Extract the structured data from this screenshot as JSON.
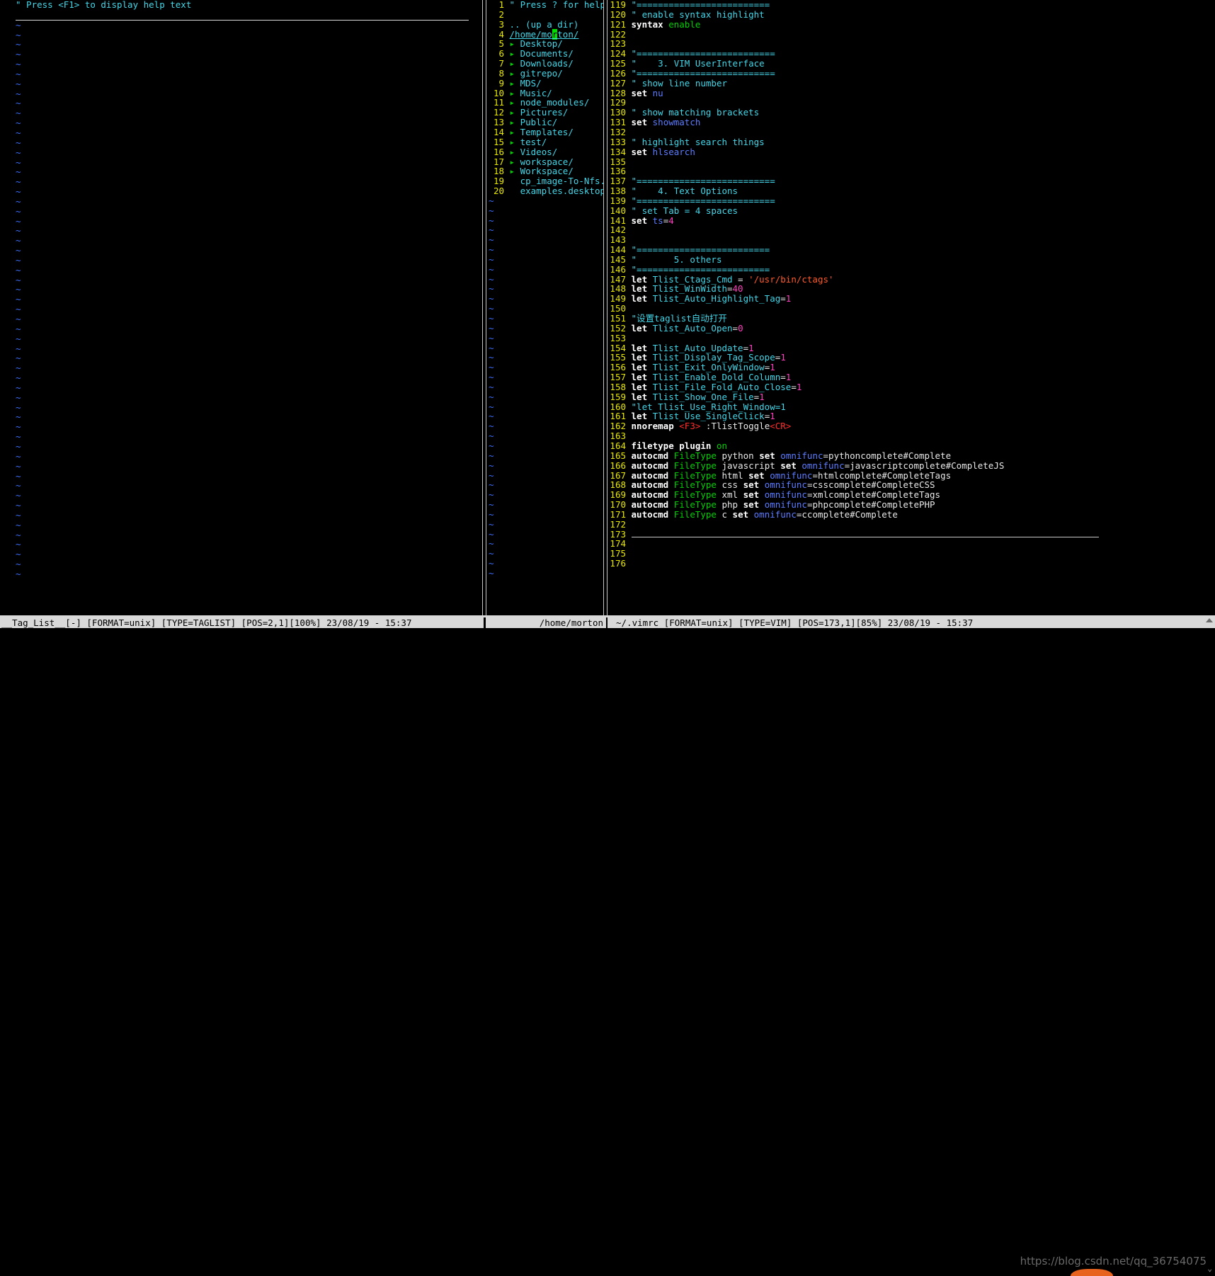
{
  "taglist": {
    "header": "\" Press <F1> to display help text",
    "tilde": "~",
    "tilde_rows": 57
  },
  "netrw": {
    "tilde": "~",
    "tilde_rows": 39,
    "lines": [
      {
        "n": "1",
        "kind": "head",
        "text": "\" Press ? for help"
      },
      {
        "n": "2",
        "kind": "blank",
        "text": ""
      },
      {
        "n": "3",
        "kind": "plain",
        "text": ".. (up a dir)"
      },
      {
        "n": "4",
        "kind": "curdir",
        "pre": "/home/mo",
        "cur": "r",
        "post": "ton/"
      },
      {
        "n": "5",
        "kind": "dir",
        "text": "Desktop/"
      },
      {
        "n": "6",
        "kind": "dir",
        "text": "Documents/"
      },
      {
        "n": "7",
        "kind": "dir",
        "text": "Downloads/"
      },
      {
        "n": "8",
        "kind": "dir",
        "text": "gitrepo/"
      },
      {
        "n": "9",
        "kind": "dir",
        "text": "MDS/"
      },
      {
        "n": "10",
        "kind": "dir",
        "text": "Music/"
      },
      {
        "n": "11",
        "kind": "dir",
        "text": "node_modules/"
      },
      {
        "n": "12",
        "kind": "dir",
        "text": "Pictures/"
      },
      {
        "n": "13",
        "kind": "dir",
        "text": "Public/"
      },
      {
        "n": "14",
        "kind": "dir",
        "text": "Templates/"
      },
      {
        "n": "15",
        "kind": "dir",
        "text": "test/"
      },
      {
        "n": "16",
        "kind": "dir",
        "text": "Videos/"
      },
      {
        "n": "17",
        "kind": "dir",
        "text": "workspace/"
      },
      {
        "n": "18",
        "kind": "dir",
        "text": "Workspace/"
      },
      {
        "n": "19",
        "kind": "file",
        "text": "cp_image-To-Nfs.sh*"
      },
      {
        "n": "20",
        "kind": "file",
        "text": "examples.desktop"
      }
    ],
    "arrow_glyph": "▸"
  },
  "vimrc": {
    "lines": [
      {
        "n": "119",
        "t": [
          {
            "c": "cmt",
            "s": "\"========================="
          }
        ]
      },
      {
        "n": "120",
        "t": [
          {
            "c": "cmt",
            "s": "\" enable syntax highlight"
          }
        ]
      },
      {
        "n": "121",
        "t": [
          {
            "c": "kw",
            "s": "syntax"
          },
          {
            "c": "wht",
            "s": " "
          },
          {
            "c": "grn",
            "s": "enable"
          }
        ]
      },
      {
        "n": "122",
        "t": []
      },
      {
        "n": "123",
        "t": []
      },
      {
        "n": "124",
        "t": [
          {
            "c": "cmt",
            "s": "\"=========================="
          }
        ]
      },
      {
        "n": "125",
        "t": [
          {
            "c": "cmt",
            "s": "\"    3. VIM UserInterface"
          }
        ]
      },
      {
        "n": "126",
        "t": [
          {
            "c": "cmt",
            "s": "\"=========================="
          }
        ]
      },
      {
        "n": "127",
        "t": [
          {
            "c": "cmt",
            "s": "\" show line number"
          }
        ]
      },
      {
        "n": "128",
        "t": [
          {
            "c": "kw",
            "s": "set"
          },
          {
            "c": "wht",
            "s": " "
          },
          {
            "c": "opt",
            "s": "nu"
          }
        ]
      },
      {
        "n": "129",
        "t": []
      },
      {
        "n": "130",
        "t": [
          {
            "c": "cmt",
            "s": "\" show matching brackets"
          }
        ]
      },
      {
        "n": "131",
        "t": [
          {
            "c": "kw",
            "s": "set"
          },
          {
            "c": "wht",
            "s": " "
          },
          {
            "c": "opt",
            "s": "showmatch"
          }
        ]
      },
      {
        "n": "132",
        "t": []
      },
      {
        "n": "133",
        "t": [
          {
            "c": "cmt",
            "s": "\" highlight search things"
          }
        ]
      },
      {
        "n": "134",
        "t": [
          {
            "c": "kw",
            "s": "set"
          },
          {
            "c": "wht",
            "s": " "
          },
          {
            "c": "opt",
            "s": "hlsearch"
          }
        ]
      },
      {
        "n": "135",
        "t": []
      },
      {
        "n": "136",
        "t": []
      },
      {
        "n": "137",
        "t": [
          {
            "c": "cmt",
            "s": "\"=========================="
          }
        ]
      },
      {
        "n": "138",
        "t": [
          {
            "c": "cmt",
            "s": "\"    4. Text Options"
          }
        ]
      },
      {
        "n": "139",
        "t": [
          {
            "c": "cmt",
            "s": "\"=========================="
          }
        ]
      },
      {
        "n": "140",
        "t": [
          {
            "c": "cmt",
            "s": "\" set Tab = 4 spaces"
          }
        ]
      },
      {
        "n": "141",
        "t": [
          {
            "c": "kw",
            "s": "set"
          },
          {
            "c": "wht",
            "s": " "
          },
          {
            "c": "opt",
            "s": "ts"
          },
          {
            "c": "wht",
            "s": "="
          },
          {
            "c": "num",
            "s": "4"
          }
        ]
      },
      {
        "n": "142",
        "t": []
      },
      {
        "n": "143",
        "t": []
      },
      {
        "n": "144",
        "t": [
          {
            "c": "cmt",
            "s": "\"========================="
          }
        ]
      },
      {
        "n": "145",
        "t": [
          {
            "c": "cmt",
            "s": "\"       5. others"
          }
        ]
      },
      {
        "n": "146",
        "t": [
          {
            "c": "cmt",
            "s": "\"========================="
          }
        ]
      },
      {
        "n": "147",
        "t": [
          {
            "c": "kw",
            "s": "let"
          },
          {
            "c": "wht",
            "s": " "
          },
          {
            "c": "id",
            "s": "Tlist_Ctags_Cmd"
          },
          {
            "c": "wht",
            "s": " = "
          },
          {
            "c": "str",
            "s": "'/usr/bin/ctags'"
          }
        ]
      },
      {
        "n": "148",
        "t": [
          {
            "c": "kw",
            "s": "let"
          },
          {
            "c": "wht",
            "s": " "
          },
          {
            "c": "id",
            "s": "Tlist_WinWidth"
          },
          {
            "c": "wht",
            "s": "="
          },
          {
            "c": "num",
            "s": "40"
          }
        ]
      },
      {
        "n": "149",
        "t": [
          {
            "c": "kw",
            "s": "let"
          },
          {
            "c": "wht",
            "s": " "
          },
          {
            "c": "id",
            "s": "Tlist_Auto_Highlight_Tag"
          },
          {
            "c": "wht",
            "s": "="
          },
          {
            "c": "num",
            "s": "1"
          }
        ]
      },
      {
        "n": "150",
        "t": []
      },
      {
        "n": "151",
        "t": [
          {
            "c": "cmt",
            "s": "\""
          },
          {
            "c": "cjk",
            "s": "设置"
          },
          {
            "c": "cmt",
            "s": "taglist"
          },
          {
            "c": "cjk",
            "s": "自动打开"
          }
        ]
      },
      {
        "n": "152",
        "t": [
          {
            "c": "kw",
            "s": "let"
          },
          {
            "c": "wht",
            "s": " "
          },
          {
            "c": "id",
            "s": "Tlist_Auto_Open"
          },
          {
            "c": "wht",
            "s": "="
          },
          {
            "c": "num",
            "s": "0"
          }
        ]
      },
      {
        "n": "153",
        "t": []
      },
      {
        "n": "154",
        "t": [
          {
            "c": "kw",
            "s": "let"
          },
          {
            "c": "wht",
            "s": " "
          },
          {
            "c": "id",
            "s": "Tlist_Auto_Update"
          },
          {
            "c": "wht",
            "s": "="
          },
          {
            "c": "num",
            "s": "1"
          }
        ]
      },
      {
        "n": "155",
        "t": [
          {
            "c": "kw",
            "s": "let"
          },
          {
            "c": "wht",
            "s": " "
          },
          {
            "c": "id",
            "s": "Tlist_Display_Tag_Scope"
          },
          {
            "c": "wht",
            "s": "="
          },
          {
            "c": "num",
            "s": "1"
          }
        ]
      },
      {
        "n": "156",
        "t": [
          {
            "c": "kw",
            "s": "let"
          },
          {
            "c": "wht",
            "s": " "
          },
          {
            "c": "id",
            "s": "Tlist_Exit_OnlyWindow"
          },
          {
            "c": "wht",
            "s": "="
          },
          {
            "c": "num",
            "s": "1"
          }
        ]
      },
      {
        "n": "157",
        "t": [
          {
            "c": "kw",
            "s": "let"
          },
          {
            "c": "wht",
            "s": " "
          },
          {
            "c": "id",
            "s": "Tlist_Enable_Dold_Column"
          },
          {
            "c": "wht",
            "s": "="
          },
          {
            "c": "num",
            "s": "1"
          }
        ]
      },
      {
        "n": "158",
        "t": [
          {
            "c": "kw",
            "s": "let"
          },
          {
            "c": "wht",
            "s": " "
          },
          {
            "c": "id",
            "s": "Tlist_File_Fold_Auto_Close"
          },
          {
            "c": "wht",
            "s": "="
          },
          {
            "c": "num",
            "s": "1"
          }
        ]
      },
      {
        "n": "159",
        "t": [
          {
            "c": "kw",
            "s": "let"
          },
          {
            "c": "wht",
            "s": " "
          },
          {
            "c": "id",
            "s": "Tlist_Show_One_File"
          },
          {
            "c": "wht",
            "s": "="
          },
          {
            "c": "num",
            "s": "1"
          }
        ]
      },
      {
        "n": "160",
        "t": [
          {
            "c": "cmt",
            "s": "\"let Tlist_Use_Right_Window=1"
          }
        ]
      },
      {
        "n": "161",
        "t": [
          {
            "c": "kw",
            "s": "let"
          },
          {
            "c": "wht",
            "s": " "
          },
          {
            "c": "id",
            "s": "Tlist_Use_SingleClick"
          },
          {
            "c": "wht",
            "s": "="
          },
          {
            "c": "num",
            "s": "1"
          }
        ]
      },
      {
        "n": "162",
        "t": [
          {
            "c": "kw",
            "s": "nnoremap"
          },
          {
            "c": "wht",
            "s": " "
          },
          {
            "c": "red",
            "s": "<F3>"
          },
          {
            "c": "wht",
            "s": " :TlistToggle"
          },
          {
            "c": "red",
            "s": "<CR>"
          }
        ]
      },
      {
        "n": "163",
        "t": []
      },
      {
        "n": "164",
        "t": [
          {
            "c": "kw",
            "s": "filetype"
          },
          {
            "c": "wht",
            "s": " "
          },
          {
            "c": "kw",
            "s": "plugin"
          },
          {
            "c": "wht",
            "s": " "
          },
          {
            "c": "grn",
            "s": "on"
          }
        ]
      },
      {
        "n": "165",
        "t": [
          {
            "c": "kw",
            "s": "autocmd"
          },
          {
            "c": "wht",
            "s": " "
          },
          {
            "c": "grn",
            "s": "FileType"
          },
          {
            "c": "wht",
            "s": " python "
          },
          {
            "c": "kw",
            "s": "set"
          },
          {
            "c": "wht",
            "s": " "
          },
          {
            "c": "opt",
            "s": "omnifunc"
          },
          {
            "c": "wht",
            "s": "=pythoncomplete#Complete"
          }
        ]
      },
      {
        "n": "166",
        "t": [
          {
            "c": "kw",
            "s": "autocmd"
          },
          {
            "c": "wht",
            "s": " "
          },
          {
            "c": "grn",
            "s": "FileType"
          },
          {
            "c": "wht",
            "s": " javascript "
          },
          {
            "c": "kw",
            "s": "set"
          },
          {
            "c": "wht",
            "s": " "
          },
          {
            "c": "opt",
            "s": "omnifunc"
          },
          {
            "c": "wht",
            "s": "=javascriptcomplete#CompleteJS"
          }
        ]
      },
      {
        "n": "167",
        "t": [
          {
            "c": "kw",
            "s": "autocmd"
          },
          {
            "c": "wht",
            "s": " "
          },
          {
            "c": "grn",
            "s": "FileType"
          },
          {
            "c": "wht",
            "s": " html "
          },
          {
            "c": "kw",
            "s": "set"
          },
          {
            "c": "wht",
            "s": " "
          },
          {
            "c": "opt",
            "s": "omnifunc"
          },
          {
            "c": "wht",
            "s": "=htmlcomplete#CompleteTags"
          }
        ]
      },
      {
        "n": "168",
        "t": [
          {
            "c": "kw",
            "s": "autocmd"
          },
          {
            "c": "wht",
            "s": " "
          },
          {
            "c": "grn",
            "s": "FileType"
          },
          {
            "c": "wht",
            "s": " css "
          },
          {
            "c": "kw",
            "s": "set"
          },
          {
            "c": "wht",
            "s": " "
          },
          {
            "c": "opt",
            "s": "omnifunc"
          },
          {
            "c": "wht",
            "s": "=csscomplete#CompleteCSS"
          }
        ]
      },
      {
        "n": "169",
        "t": [
          {
            "c": "kw",
            "s": "autocmd"
          },
          {
            "c": "wht",
            "s": " "
          },
          {
            "c": "grn",
            "s": "FileType"
          },
          {
            "c": "wht",
            "s": " xml "
          },
          {
            "c": "kw",
            "s": "set"
          },
          {
            "c": "wht",
            "s": " "
          },
          {
            "c": "opt",
            "s": "omnifunc"
          },
          {
            "c": "wht",
            "s": "=xmlcomplete#CompleteTags"
          }
        ]
      },
      {
        "n": "170",
        "t": [
          {
            "c": "kw",
            "s": "autocmd"
          },
          {
            "c": "wht",
            "s": " "
          },
          {
            "c": "grn",
            "s": "FileType"
          },
          {
            "c": "wht",
            "s": " php "
          },
          {
            "c": "kw",
            "s": "set"
          },
          {
            "c": "wht",
            "s": " "
          },
          {
            "c": "opt",
            "s": "omnifunc"
          },
          {
            "c": "wht",
            "s": "=phpcomplete#CompletePHP"
          }
        ]
      },
      {
        "n": "171",
        "t": [
          {
            "c": "kw",
            "s": "autocmd"
          },
          {
            "c": "wht",
            "s": " "
          },
          {
            "c": "grn",
            "s": "FileType"
          },
          {
            "c": "wht",
            "s": " c "
          },
          {
            "c": "kw",
            "s": "set"
          },
          {
            "c": "wht",
            "s": " "
          },
          {
            "c": "opt",
            "s": "omnifunc"
          },
          {
            "c": "wht",
            "s": "=ccomplete#Complete"
          }
        ]
      },
      {
        "n": "172",
        "t": []
      },
      {
        "n": "173",
        "t": [
          {
            "c": "rule",
            "s": ""
          }
        ]
      },
      {
        "n": "174",
        "t": []
      },
      {
        "n": "175",
        "t": []
      },
      {
        "n": "176",
        "t": []
      }
    ]
  },
  "status": {
    "left": "__Tag_List__[-] [FORMAT=unix] [TYPE=TAGLIST] [POS=2,1][100%] 23/08/19 - 15:37",
    "middle": "/home/morton",
    "right": "~/.vimrc [FORMAT=unix] [TYPE=VIM] [POS=173,1][85%] 23/08/19 - 15:37"
  },
  "watermark": "https://blog.csdn.net/qq_36754075",
  "scroll_chevron": "⌄",
  "colors": {
    "background": "#000000",
    "comment": "#43d6e8",
    "keyword": "#ffffff",
    "option": "#5c7cff",
    "identifier": "#43d6e8",
    "number": "#ff3fc0",
    "string": "#ff5a2b",
    "special": "#ff2b2b",
    "constant": "#00d000",
    "linenumber": "#e8e800",
    "cursor": "#00e000",
    "statusbar_bg": "#d9d9d9",
    "statusbar_fg": "#000000",
    "tilde": "#3b6eff"
  }
}
